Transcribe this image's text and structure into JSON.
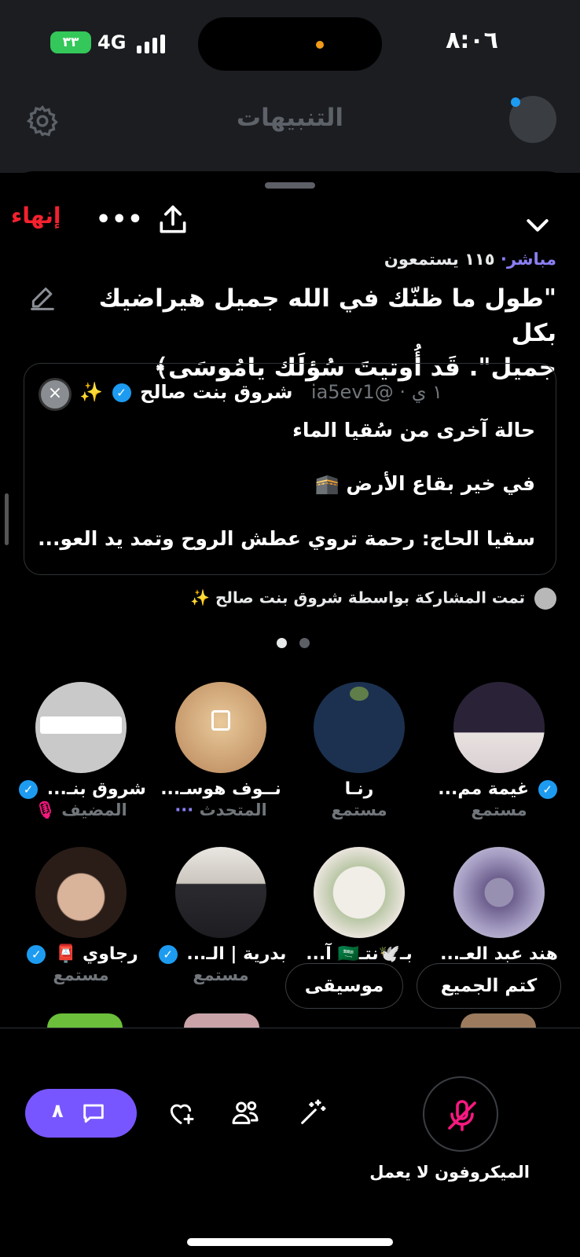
{
  "status_bar": {
    "time": "٨:٠٦",
    "network": "4G",
    "battery": "٣٣"
  },
  "background_header": {
    "title": "التنبيهات",
    "settings_icon": "gear-icon"
  },
  "space": {
    "end_label": "إنهاء",
    "live_label": "مباشر",
    "listeners": "١١٥ يستمعون",
    "title_line1": "\"طول ما ظنّك في الله جميل هيراضيك بكل",
    "title_line2": "جميل\". قَد أُوتيتَ سُؤلَك يامُوسَى﴾"
  },
  "pinned_tweet": {
    "author": "شروق بنت صالح",
    "sparkle": "✨",
    "handle": "@ia5ev1",
    "time": "١ ي",
    "line1": "حالة آخرى من سُقيا الماء",
    "line2": "في خير بقاع الأرض 🕋",
    "line3": "سقيا الحاج: رحمة تروي عطش الروح وتمد يد العو..."
  },
  "shared_by": "تمت المشاركة بواسطة شروق بنت صالح ✨",
  "speakers": [
    {
      "name": "شروق بنـ...",
      "role": "المضيف",
      "verified": true
    },
    {
      "name": "نــوف هوسـ...",
      "role": "المتحدث",
      "verified": false
    },
    {
      "name": "رنـا",
      "role": "مستمع",
      "verified": false
    },
    {
      "name": "غيمة مم...",
      "role": "مستمع",
      "verified": true
    },
    {
      "name": "رجاوي 📮",
      "role": "مستمع",
      "verified": true
    },
    {
      "name": "بدرية | الـ...",
      "role": "مستمع",
      "verified": true
    },
    {
      "name": "بـ🕊️نتـ🇸🇦 آ...",
      "role": "",
      "verified": false
    },
    {
      "name": "هند عبد العـ...",
      "role": "",
      "verified": false
    }
  ],
  "actions": {
    "music": "موسيقى",
    "mute_all": "كتم الجميع"
  },
  "bottom": {
    "chat_count": "٨",
    "mic_label": "الميكروفون لا يعمل"
  }
}
